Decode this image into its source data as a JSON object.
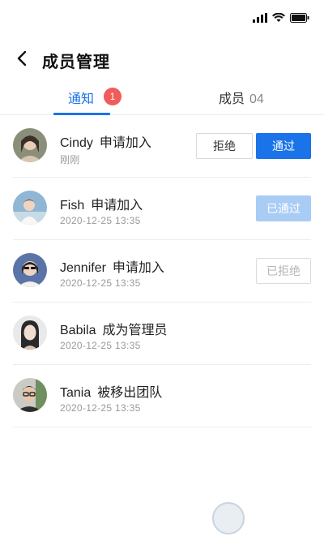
{
  "header": {
    "title": "成员管理"
  },
  "tabs": {
    "notice_label": "通知",
    "notice_badge": "1",
    "members_label": "成员",
    "members_count": "04"
  },
  "rows": [
    {
      "name": "Cindy",
      "action": "申请加入",
      "time": "刚刚",
      "reject_label": "拒绝",
      "approve_label": "通过"
    },
    {
      "name": "Fish",
      "action": "申请加入",
      "time": "2020-12-25  13:35",
      "status_label": "已通过"
    },
    {
      "name": "Jennifer",
      "action": "申请加入",
      "time": "2020-12-25  13:35",
      "status_label": "已拒绝"
    },
    {
      "name": "Babila",
      "action": "成为管理员",
      "time": "2020-12-25  13:35"
    },
    {
      "name": "Tania",
      "action": "被移出团队",
      "time": "2020-12-25  13:35"
    }
  ],
  "colors": {
    "accent": "#1a73e8",
    "badge": "#f15b5b",
    "approved": "#a9ccf5"
  },
  "icons": {
    "back": "chevron-left-icon",
    "signal": "signal-icon",
    "wifi": "wifi-icon",
    "battery": "battery-icon"
  }
}
